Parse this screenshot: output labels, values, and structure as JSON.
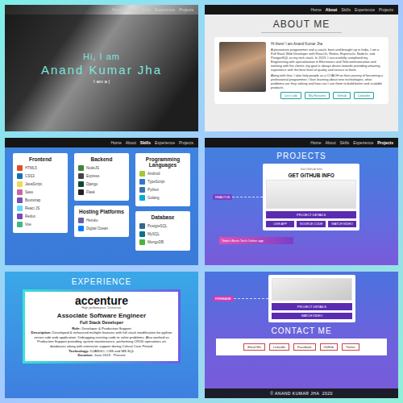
{
  "hero": {
    "nav": [
      {
        "label": "Home",
        "selected": false
      },
      {
        "label": "About",
        "selected": false
      },
      {
        "label": "Skills",
        "selected": false
      },
      {
        "label": "Experience",
        "selected": false
      },
      {
        "label": "Projects",
        "selected": false
      }
    ],
    "greeting": "Hi, I am",
    "name": "Anand Kumar Jha",
    "tagline": "I am a |"
  },
  "about": {
    "nav": [
      {
        "label": "Home",
        "selected": false
      },
      {
        "label": "About",
        "selected": true
      },
      {
        "label": "Skills",
        "selected": false
      },
      {
        "label": "Experience",
        "selected": false
      },
      {
        "label": "Projects",
        "selected": false
      }
    ],
    "title": "ABOUT ME",
    "intro": "Hi there! I am Anand Kumar Jha",
    "paragraphs": [
      "A passionate programmer and a coach, born and brought up in India. I am a Full Stack Web Developer with ReactJs, Redux, ExpressJs, NodeJs, and PostgreSQL as my tech stack. In 2019, I successfully completed my Engineering with specialization in Electronics and Telecommunication and working with the clients, my goal is always driven towards providing amazing experience with the best level of quality and service to them.",
      "Along with that, I also help people as a COACH on their journey of becoming a professional programmer. I love learning about new technologies, what problems are they solving and how can I use them to build better and scalable products."
    ],
    "buttons": [
      "Let's talk",
      "My Resume",
      "Github",
      "Linkedin"
    ]
  },
  "skills": {
    "nav": [
      {
        "label": "Home",
        "selected": false
      },
      {
        "label": "About",
        "selected": false
      },
      {
        "label": "Skills",
        "selected": true
      },
      {
        "label": "Experience",
        "selected": false
      },
      {
        "label": "Projects",
        "selected": false
      }
    ],
    "columns": [
      {
        "cards": [
          {
            "title": "Frontend",
            "items": [
              {
                "label": "HTML5",
                "color": "#e44d26"
              },
              {
                "label": "CSS3",
                "color": "#1572b6"
              },
              {
                "label": "JavaScript",
                "color": "#f0db4f"
              },
              {
                "label": "Sass",
                "color": "#cc6699"
              },
              {
                "label": "Bootstrap",
                "color": "#7952b3"
              },
              {
                "label": "React JS",
                "color": "#61dafb"
              },
              {
                "label": "Redux",
                "color": "#764abc"
              },
              {
                "label": "Vue",
                "color": "#41b883"
              }
            ]
          }
        ]
      },
      {
        "cards": [
          {
            "title": "Backend",
            "items": [
              {
                "label": "NodeJS",
                "color": "#3c873a"
              },
              {
                "label": "Express",
                "color": "#444444"
              },
              {
                "label": "Django",
                "color": "#0c4b33"
              },
              {
                "label": "Flask",
                "color": "#222222"
              }
            ]
          },
          {
            "title": "Hosting Platforms",
            "items": [
              {
                "label": "Heroku",
                "color": "#6762a6"
              },
              {
                "label": "Digital Ocean",
                "color": "#0080ff"
              }
            ]
          }
        ]
      },
      {
        "cards": [
          {
            "title": "Programming Languages",
            "items": [
              {
                "label": "Android",
                "color": "#a4c639"
              },
              {
                "label": "TypeScript",
                "color": "#3178c6"
              },
              {
                "label": "Python",
                "color": "#3776ab"
              },
              {
                "label": "Golang",
                "color": "#00add8"
              }
            ]
          },
          {
            "title": "Database",
            "items": [
              {
                "label": "PostgreSQL",
                "color": "#336791"
              },
              {
                "label": "MySQL",
                "color": "#00758f"
              },
              {
                "label": "MongoDB",
                "color": "#4db33d"
              }
            ]
          }
        ]
      }
    ]
  },
  "projects": {
    "nav": [
      {
        "label": "Home",
        "selected": false
      },
      {
        "label": "About",
        "selected": false
      },
      {
        "label": "Skills",
        "selected": false
      },
      {
        "label": "Experience",
        "selected": false
      },
      {
        "label": "Projects",
        "selected": true
      }
    ],
    "title": "PROJECTS",
    "tag": "REACTJS",
    "card": {
      "header": "Get Github Info",
      "name": "GET GITHUB INFO",
      "details": "PROJECT DETAILS",
      "links": [
        "LIVE APP",
        "SOURCE CODE",
        "WATCH VIDEO"
      ]
    },
    "next": "Todo's Brain Tech Online app"
  },
  "experience": {
    "title": "EXPERIENCE",
    "company": "accenture",
    "slogan": "High performance. Delivered.",
    "role": "Associate Software Engineer",
    "subtitle": "Full Stack Developer",
    "lines": [
      {
        "label": "Role:",
        "value": "Developer & Production Support"
      },
      {
        "label": "Description:",
        "value": "Developed & enhanced multiple features with full stack modification for python server-side web application. Debugging existing code to solve problems. Also worked as Production Support providing system maintenance, performing CRUD operations on databases along with extensive support during Critical Care Period."
      },
      {
        "label": "Technology:",
        "value": "DJANGO, CSS and MS SQL"
      },
      {
        "label": "Duration:",
        "value": "June 2019 - Present"
      }
    ]
  },
  "contact": {
    "tag": "FIREBASE",
    "details": "PROJECT DETAILS",
    "video": "WATCH VIDEO",
    "title": "CONTACT ME",
    "buttons": [
      "Email Me",
      "LinkedIn",
      "Facebook",
      "GitHub",
      "Twitter"
    ],
    "footer": "© ANAND KUMAR JHA  2020"
  }
}
